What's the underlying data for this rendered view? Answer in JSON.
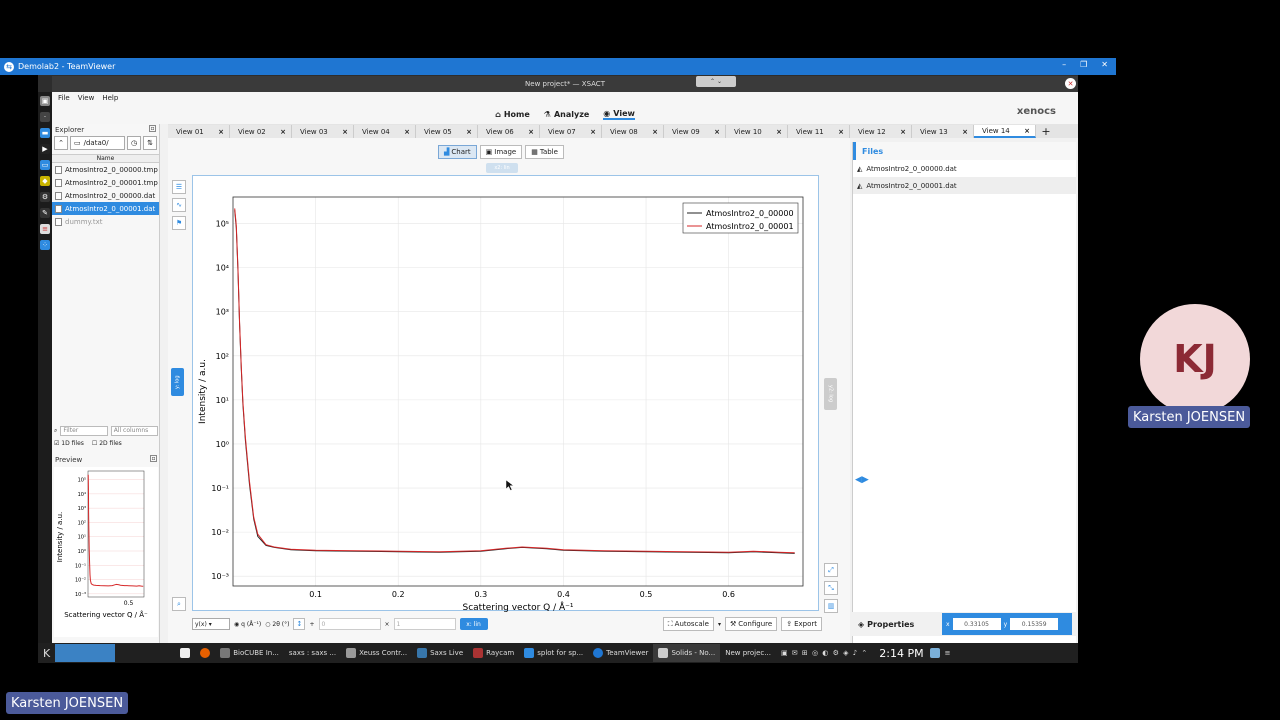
{
  "teamviewer": {
    "title": "Demolab2 - TeamViewer",
    "min": "–",
    "restore": "❐",
    "close": "✕"
  },
  "app": {
    "title": "New project* — XSACT"
  },
  "menu": [
    "File",
    "View",
    "Help"
  ],
  "modes": [
    {
      "label": "Home",
      "icon": "home-icon"
    },
    {
      "label": "Analyze",
      "icon": "flask-icon"
    },
    {
      "label": "View",
      "icon": "eye-icon"
    }
  ],
  "logo": "xenocs",
  "explorer": {
    "title": "Explorer",
    "path": "/data0/",
    "column": "Name",
    "files": [
      {
        "name": "AtmosIntro2_0_00000.tmp",
        "state": "normal"
      },
      {
        "name": "AtmosIntro2_0_00001.tmp",
        "state": "normal"
      },
      {
        "name": "AtmosIntro2_0_00000.dat",
        "state": "normal"
      },
      {
        "name": "AtmosIntro2_0_00001.dat",
        "state": "selected"
      },
      {
        "name": "dummy.txt",
        "state": "dim"
      }
    ],
    "filter_placeholder": "Filter",
    "columns_label": "All columns",
    "type_1d": "1D files",
    "type_2d": "2D files",
    "preview_title": "Preview",
    "preview_ylabel": "Intensity / a.u.",
    "preview_xlabel": "Scattering vector Q / Å⁻",
    "preview_xtick": "0.5",
    "preview_yticks": [
      "10⁵",
      "10⁴",
      "10³",
      "10²",
      "10¹",
      "10⁰",
      "10⁻¹",
      "10⁻²",
      "10⁻³"
    ]
  },
  "tabs": [
    "View 01",
    "View 02",
    "View 03",
    "View 04",
    "View 05",
    "View 06",
    "View 07",
    "View 08",
    "View 09",
    "View 10",
    "View 11",
    "View 12",
    "View 13",
    "View 14"
  ],
  "active_tab": 13,
  "view_modes": [
    "Chart",
    "Image",
    "Table"
  ],
  "x2_pill": "x2: lin",
  "y_scale_pill": "y: log",
  "y2_scale_pill": "y2: log",
  "bottom": {
    "y_select": "y(x)",
    "q_option": "q (Å⁻¹)",
    "theta_option": "2θ (°)",
    "min_placeholder": "0",
    "max_placeholder": "1",
    "x_scale": "x: lin",
    "autoscale": "Autoscale",
    "configure": "Configure",
    "export": "Export"
  },
  "files_panel": {
    "title": "Files",
    "items": [
      "AtmosIntro2_0_00000.dat",
      "AtmosIntro2_0_00001.dat"
    ]
  },
  "properties": {
    "title": "Properties",
    "x_label": "x",
    "x_value": "0.33105",
    "y_label": "y",
    "y_value": "0.15359"
  },
  "taskbar": {
    "items": [
      "BioCUBE In...",
      "saxs : saxs ...",
      "Xeuss Contr...",
      "Saxs Live",
      "Raycam",
      "splot for sp...",
      "TeamViewer",
      "Solids - No...",
      "New projec..."
    ],
    "clock": "2:14 PM"
  },
  "participant": {
    "initials": "KJ",
    "name": "Karsten JOENSEN"
  },
  "colors": {
    "series1": "#222222",
    "series2": "#d62728",
    "accent": "#2f8be0"
  },
  "chart_data": {
    "type": "line",
    "xlabel": "Scattering vector Q / Å⁻¹",
    "ylabel": "Intensity / a.u.",
    "yscale": "log",
    "xlim": [
      0,
      0.69
    ],
    "ylim": [
      0.0006,
      400000
    ],
    "xticks": [
      "0.1",
      "0.2",
      "0.3",
      "0.4",
      "0.5",
      "0.6"
    ],
    "yticks": [
      "10⁵",
      "10⁴",
      "10³",
      "10²",
      "10¹",
      "10⁰",
      "10⁻¹",
      "10⁻²",
      "10⁻³"
    ],
    "legend_position": "top-right",
    "grid": true,
    "series": [
      {
        "name": "AtmosIntro2_0_00000",
        "color": "#222222",
        "x": [
          0.002,
          0.004,
          0.006,
          0.008,
          0.01,
          0.012,
          0.015,
          0.02,
          0.025,
          0.03,
          0.04,
          0.05,
          0.07,
          0.1,
          0.15,
          0.2,
          0.25,
          0.3,
          0.33,
          0.35,
          0.38,
          0.4,
          0.45,
          0.5,
          0.55,
          0.6,
          0.63,
          0.66,
          0.68
        ],
        "y": [
          200000,
          80000,
          8000,
          500,
          50,
          8,
          1.2,
          0.12,
          0.02,
          0.008,
          0.005,
          0.0045,
          0.004,
          0.0038,
          0.0037,
          0.0036,
          0.0035,
          0.0037,
          0.0042,
          0.0045,
          0.0042,
          0.0039,
          0.0037,
          0.0036,
          0.0035,
          0.0034,
          0.0036,
          0.0034,
          0.0033
        ]
      },
      {
        "name": "AtmosIntro2_0_00001",
        "color": "#d62728",
        "x": [
          0.002,
          0.004,
          0.006,
          0.008,
          0.01,
          0.012,
          0.015,
          0.02,
          0.025,
          0.03,
          0.04,
          0.05,
          0.07,
          0.1,
          0.15,
          0.2,
          0.25,
          0.3,
          0.33,
          0.35,
          0.38,
          0.4,
          0.45,
          0.5,
          0.55,
          0.6,
          0.63,
          0.66,
          0.68
        ],
        "y": [
          220000,
          90000,
          9000,
          550,
          55,
          9,
          1.4,
          0.14,
          0.022,
          0.009,
          0.0052,
          0.0046,
          0.0041,
          0.0039,
          0.0038,
          0.0037,
          0.0036,
          0.0038,
          0.0043,
          0.0046,
          0.0043,
          0.004,
          0.0038,
          0.0037,
          0.0036,
          0.0035,
          0.0037,
          0.0035,
          0.0034
        ]
      }
    ]
  }
}
